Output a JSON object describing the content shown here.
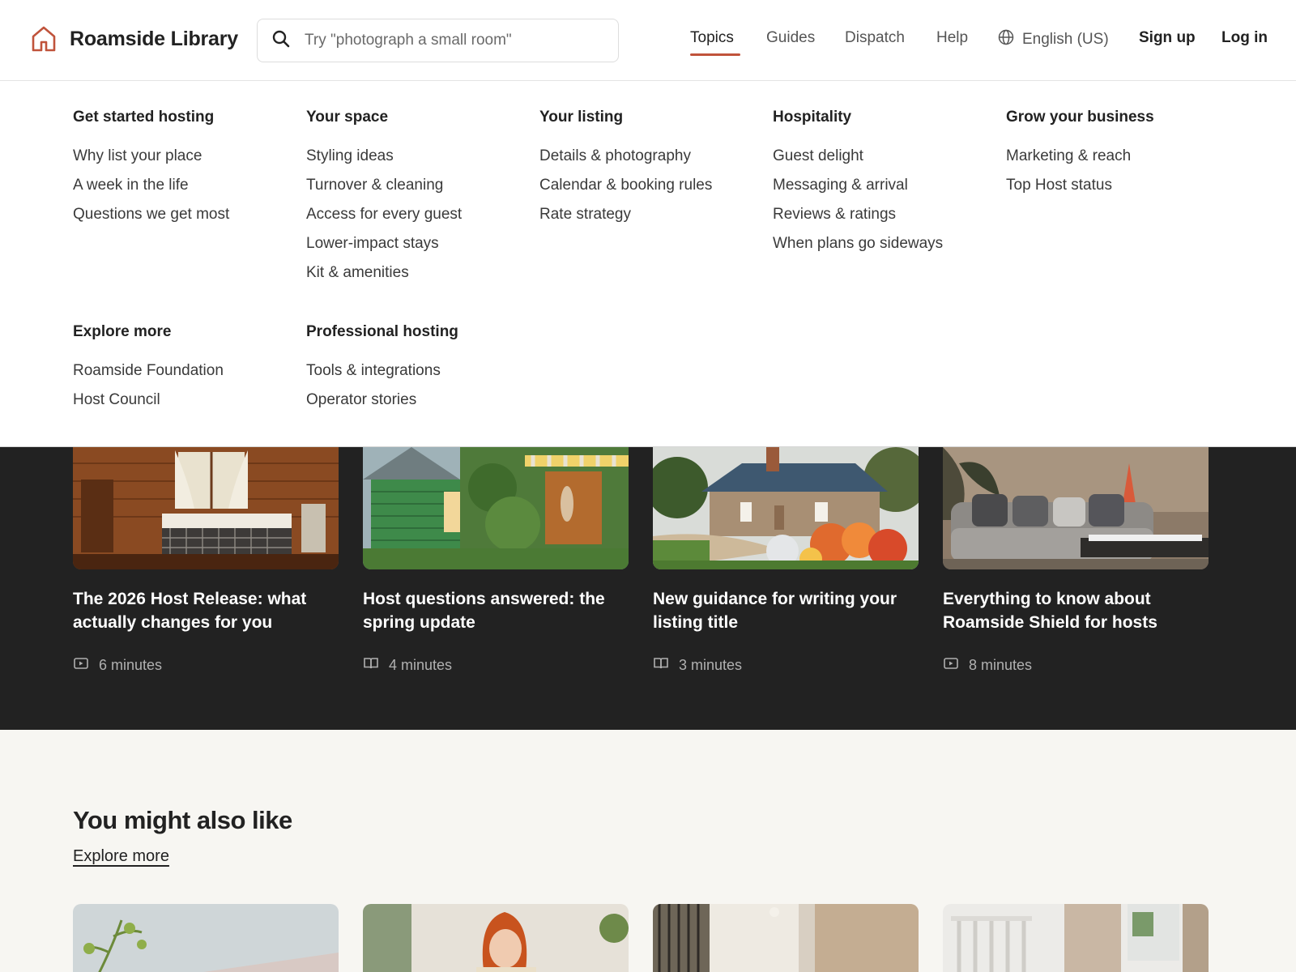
{
  "header": {
    "brand": "Roamside Library",
    "search_placeholder": "Try \"photograph a small room\"",
    "nav": [
      "Topics",
      "Guides",
      "Dispatch",
      "Help"
    ],
    "active_nav": "Topics",
    "language": "English (US)",
    "sign_up": "Sign up",
    "log_in": "Log in",
    "accent_color": "#c0533b"
  },
  "menu": {
    "columns": [
      {
        "title": "Get started hosting",
        "items": [
          "Why list your place",
          "A week in the life",
          "Questions we get most"
        ]
      },
      {
        "title": "Your space",
        "items": [
          "Styling ideas",
          "Turnover & cleaning",
          "Access for every guest",
          "Lower-impact stays",
          "Kit & amenities"
        ]
      },
      {
        "title": "Your listing",
        "items": [
          "Details & photography",
          "Calendar & booking rules",
          "Rate strategy"
        ]
      },
      {
        "title": "Hospitality",
        "items": [
          "Guest delight",
          "Messaging & arrival",
          "Reviews & ratings",
          "When plans go sideways"
        ]
      },
      {
        "title": "Grow your business",
        "items": [
          "Marketing & reach",
          "Top Host status"
        ]
      },
      {
        "title": "Explore more",
        "items": [
          "Roamside Foundation",
          "Host Council"
        ]
      },
      {
        "title": "Professional hosting",
        "items": [
          "Tools & integrations",
          "Operator stories"
        ]
      }
    ]
  },
  "featured": [
    {
      "title": "The 2026 Host Release: what actually changes for you",
      "duration": "6 minutes",
      "icon": "video-icon"
    },
    {
      "title": "Host questions answered: the spring update",
      "duration": "4 minutes",
      "icon": "book-icon"
    },
    {
      "title": "New guidance for writing your listing title",
      "duration": "3 minutes",
      "icon": "book-icon"
    },
    {
      "title": "Everything to know about Roamside Shield for hosts",
      "duration": "8 minutes",
      "icon": "video-icon"
    }
  ],
  "related": {
    "heading": "You might also like",
    "explore_label": "Explore more"
  }
}
